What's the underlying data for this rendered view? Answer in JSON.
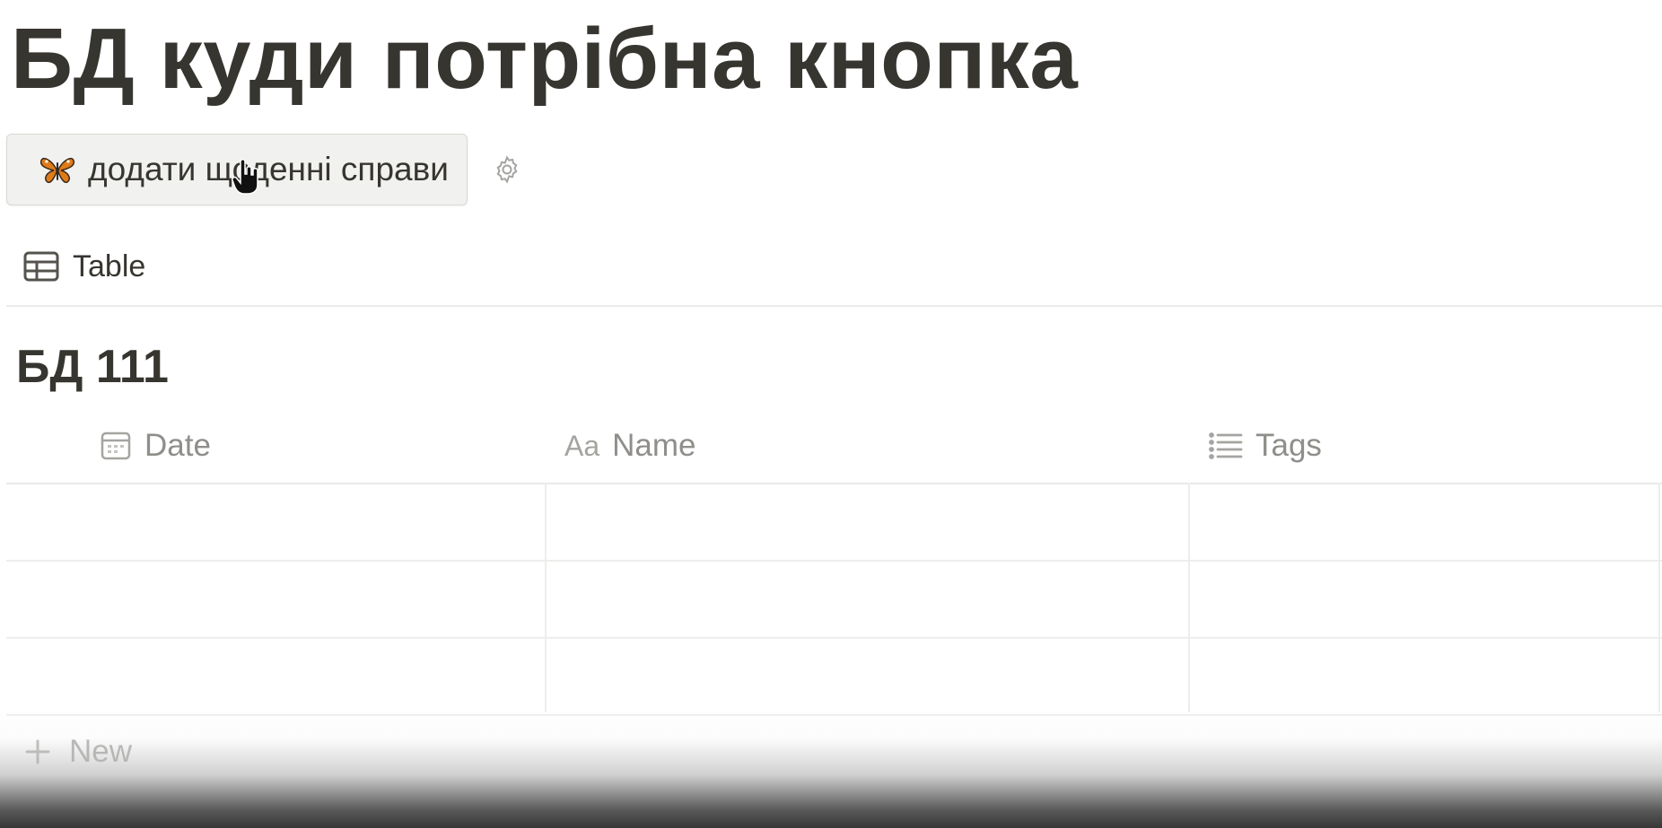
{
  "page": {
    "title": "БД куди потрібна кнопка"
  },
  "action_button": {
    "label": "додати щоденні справи",
    "emoji": "butterfly-emoji"
  },
  "view": {
    "tab_label": "Table",
    "tab_icon": "table-icon"
  },
  "database": {
    "title": "БД 111",
    "columns": [
      {
        "label": "Date",
        "icon": "calendar-icon"
      },
      {
        "label": "Name",
        "icon": "text-aa-icon",
        "icon_text": "Aa"
      },
      {
        "label": "Tags",
        "icon": "list-icon"
      }
    ],
    "rows": [
      {
        "date": "",
        "name": "",
        "tags": ""
      },
      {
        "date": "",
        "name": "",
        "tags": ""
      },
      {
        "date": "",
        "name": "",
        "tags": ""
      }
    ],
    "new_label": "New"
  },
  "colors": {
    "text": "#37352f",
    "muted": "#8f8e8a",
    "button_bg": "#f1f1ef",
    "border": "#e9e9e7"
  }
}
